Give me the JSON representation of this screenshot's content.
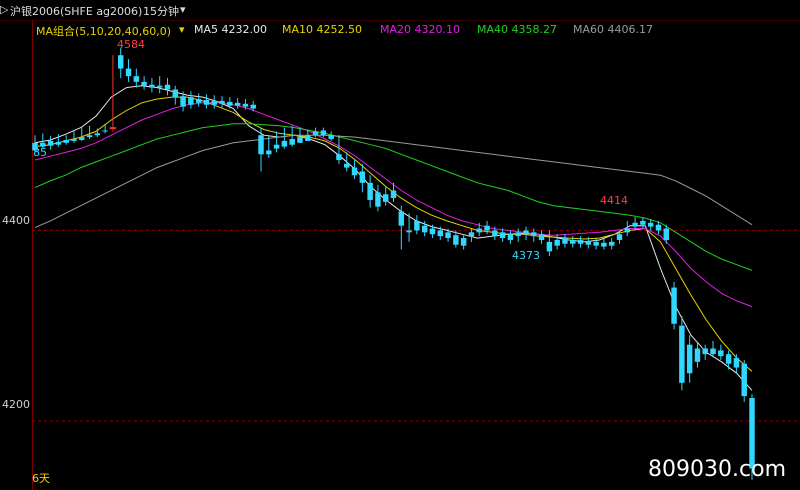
{
  "header": {
    "symbol": "沪银2006(SHFE ag2006)",
    "period": "15分钟",
    "period_caret": "▾",
    "left_caret": "▷"
  },
  "ma_group": {
    "label": "MA组合(5,10,20,40,60,0)",
    "dropdown": "▾",
    "items": [
      {
        "label": "MA5 4232.00",
        "color": "#e8e8e8"
      },
      {
        "label": "MA10 4252.50",
        "color": "#e6d400"
      },
      {
        "label": "MA20 4320.10",
        "color": "#e020e0"
      },
      {
        "label": "MA40 4358.27",
        "color": "#20d020"
      },
      {
        "label": "MA60 4406.17",
        "color": "#9a9a9a"
      }
    ]
  },
  "annotations": {
    "high1": "4584",
    "high2": "4414",
    "low1": "4373",
    "left_cut": "85"
  },
  "footer": {
    "days": "6天",
    "watermark": "809030.com"
  },
  "chart_data": {
    "type": "candlestick",
    "y_ticks": [
      4400,
      4200
    ],
    "ylim": [
      4140,
      4600
    ],
    "colors": {
      "up": "#ff3030",
      "down": "#30d8ff",
      "grid": "#8a0000"
    },
    "candles": [
      [
        4492,
        4500,
        4484,
        4482
      ],
      [
        4492,
        4502,
        4488,
        4486
      ],
      [
        4494,
        4499,
        4489,
        4485
      ],
      [
        4493,
        4501,
        4490,
        4488
      ],
      [
        4495,
        4500,
        4492,
        4490
      ],
      [
        4496,
        4505,
        4494,
        4492
      ],
      [
        4498,
        4508,
        4495,
        4494
      ],
      [
        4500,
        4510,
        4498,
        4496
      ],
      [
        4502,
        4507,
        4500,
        4498
      ],
      [
        4505,
        4512,
        4504,
        4502
      ],
      [
        4508,
        4584,
        4508,
        4504
      ],
      [
        4584,
        4592,
        4570,
        4560
      ],
      [
        4570,
        4580,
        4562,
        4556
      ],
      [
        4562,
        4570,
        4556,
        4550
      ],
      [
        4556,
        4562,
        4552,
        4548
      ],
      [
        4553,
        4560,
        4550,
        4545
      ],
      [
        4552,
        4562,
        4550,
        4544
      ],
      [
        4553,
        4560,
        4548,
        4542
      ],
      [
        4548,
        4552,
        4540,
        4532
      ],
      [
        4541,
        4546,
        4530,
        4525
      ],
      [
        4540,
        4546,
        4532,
        4528
      ],
      [
        4538,
        4544,
        4534,
        4530
      ],
      [
        4537,
        4543,
        4532,
        4528
      ],
      [
        4536,
        4542,
        4532,
        4528
      ],
      [
        4536,
        4541,
        4533,
        4529
      ],
      [
        4535,
        4540,
        4531,
        4528
      ],
      [
        4534,
        4539,
        4531,
        4528
      ],
      [
        4533,
        4538,
        4530,
        4527
      ],
      [
        4532,
        4536,
        4528,
        4525
      ],
      [
        4500,
        4508,
        4480,
        4462
      ],
      [
        4484,
        4500,
        4480,
        4476
      ],
      [
        4490,
        4504,
        4486,
        4482
      ],
      [
        4494,
        4508,
        4488,
        4486
      ],
      [
        4496,
        4510,
        4490,
        4488
      ],
      [
        4498,
        4508,
        4492,
        4492
      ],
      [
        4500,
        4506,
        4494,
        4494
      ],
      [
        4504,
        4508,
        4500,
        4498
      ],
      [
        4505,
        4508,
        4500,
        4498
      ],
      [
        4500,
        4504,
        4496,
        4494
      ],
      [
        4480,
        4500,
        4474,
        4470
      ],
      [
        4470,
        4482,
        4466,
        4462
      ],
      [
        4466,
        4474,
        4458,
        4454
      ],
      [
        4462,
        4470,
        4450,
        4440
      ],
      [
        4450,
        4458,
        4432,
        4424
      ],
      [
        4440,
        4448,
        4425,
        4420
      ],
      [
        4438,
        4446,
        4430,
        4426
      ],
      [
        4442,
        4450,
        4434,
        4430
      ],
      [
        4420,
        4426,
        4405,
        4380
      ],
      [
        4400,
        4418,
        4398,
        4388
      ],
      [
        4410,
        4416,
        4400,
        4396
      ],
      [
        4405,
        4410,
        4398,
        4394
      ],
      [
        4402,
        4406,
        4396,
        4392
      ],
      [
        4400,
        4404,
        4394,
        4390
      ],
      [
        4398,
        4402,
        4392,
        4388
      ],
      [
        4395,
        4400,
        4385,
        4382
      ],
      [
        4392,
        4396,
        4384,
        4380
      ],
      [
        4398,
        4402,
        4394,
        4388
      ],
      [
        4402,
        4408,
        4398,
        4394
      ],
      [
        4405,
        4410,
        4400,
        4396
      ],
      [
        4400,
        4404,
        4394,
        4390
      ],
      [
        4398,
        4402,
        4392,
        4388
      ],
      [
        4396,
        4400,
        4390,
        4386
      ],
      [
        4398,
        4402,
        4394,
        4388
      ],
      [
        4400,
        4404,
        4396,
        4390
      ],
      [
        4398,
        4402,
        4394,
        4388
      ],
      [
        4396,
        4400,
        4390,
        4386
      ],
      [
        4388,
        4400,
        4378,
        4373
      ],
      [
        4390,
        4396,
        4384,
        4380
      ],
      [
        4392,
        4396,
        4386,
        4382
      ],
      [
        4390,
        4394,
        4386,
        4382
      ],
      [
        4390,
        4394,
        4386,
        4382
      ],
      [
        4389,
        4393,
        4385,
        4381
      ],
      [
        4388,
        4392,
        4384,
        4380
      ],
      [
        4387,
        4391,
        4383,
        4380
      ],
      [
        4388,
        4392,
        4384,
        4380
      ],
      [
        4396,
        4400,
        4390,
        4386
      ],
      [
        4402,
        4410,
        4398,
        4394
      ],
      [
        4408,
        4414,
        4404,
        4400
      ],
      [
        4410,
        4414,
        4406,
        4402
      ],
      [
        4408,
        4412,
        4404,
        4400
      ],
      [
        4406,
        4410,
        4400,
        4396
      ],
      [
        4402,
        4406,
        4390,
        4386
      ],
      [
        4340,
        4346,
        4302,
        4296
      ],
      [
        4300,
        4310,
        4240,
        4232
      ],
      [
        4280,
        4290,
        4250,
        4240
      ],
      [
        4276,
        4282,
        4262,
        4256
      ],
      [
        4276,
        4280,
        4270,
        4264
      ],
      [
        4276,
        4284,
        4270,
        4268
      ],
      [
        4274,
        4280,
        4268,
        4264
      ],
      [
        4270,
        4274,
        4260,
        4254
      ],
      [
        4266,
        4270,
        4256,
        4250
      ],
      [
        4260,
        4264,
        4226,
        4220
      ],
      [
        4224,
        4228,
        4150,
        4138
      ]
    ],
    "ma_series": [
      {
        "name": "MA5",
        "color": "#e8e8e8",
        "values": [
          4492,
          4495,
          4501,
          4508,
          4520,
          4540,
          4550,
          4552,
          4550,
          4546,
          4542,
          4540,
          4535,
          4528,
          4510,
          4500,
          4498,
          4500,
          4496,
          4490,
          4478,
          4464,
          4446,
          4432,
          4420,
          4410,
          4404,
          4400,
          4396,
          4392,
          4394,
          4396,
          4397,
          4396,
          4393,
          4390,
          4388,
          4390,
          4396,
          4405,
          4405,
          4360,
          4320,
          4290,
          4272,
          4262,
          4250,
          4232
        ]
      },
      {
        "name": "MA10",
        "color": "#e6d400",
        "values": [
          4488,
          4490,
          4494,
          4498,
          4504,
          4516,
          4526,
          4534,
          4538,
          4540,
          4540,
          4536,
          4530,
          4524,
          4514,
          4506,
          4502,
          4500,
          4498,
          4494,
          4486,
          4474,
          4460,
          4446,
          4434,
          4424,
          4416,
          4410,
          4405,
          4400,
          4398,
          4396,
          4396,
          4394,
          4393,
          4392,
          4391,
          4392,
          4396,
          4400,
          4402,
          4388,
          4360,
          4332,
          4306,
          4284,
          4266,
          4252
        ]
      },
      {
        "name": "MA20",
        "color": "#e020e0",
        "values": [
          4474,
          4478,
          4482,
          4486,
          4492,
          4500,
          4508,
          4516,
          4522,
          4528,
          4532,
          4534,
          4534,
          4532,
          4528,
          4522,
          4516,
          4510,
          4504,
          4496,
          4488,
          4478,
          4466,
          4454,
          4442,
          4432,
          4424,
          4416,
          4410,
          4406,
          4402,
          4400,
          4398,
          4396,
          4395,
          4396,
          4397,
          4398,
          4400,
          4402,
          4402,
          4394,
          4378,
          4360,
          4346,
          4334,
          4326,
          4320
        ]
      },
      {
        "name": "MA40",
        "color": "#20d020",
        "values": [
          4445,
          4452,
          4458,
          4466,
          4472,
          4478,
          4484,
          4490,
          4496,
          4500,
          4504,
          4508,
          4510,
          4512,
          4512,
          4511,
          4510,
          4508,
          4505,
          4502,
          4498,
          4494,
          4490,
          4486,
          4480,
          4474,
          4468,
          4462,
          4456,
          4450,
          4446,
          4442,
          4436,
          4430,
          4426,
          4424,
          4422,
          4420,
          4418,
          4416,
          4413,
          4408,
          4398,
          4388,
          4378,
          4370,
          4364,
          4358
        ]
      },
      {
        "name": "MA60",
        "color": "#9a9a9a",
        "values": [
          4403,
          4410,
          4418,
          4426,
          4434,
          4442,
          4450,
          4458,
          4466,
          4472,
          4478,
          4484,
          4488,
          4492,
          4494,
          4496,
          4498,
          4500,
          4500,
          4500,
          4499,
          4498,
          4496,
          4494,
          4492,
          4490,
          4488,
          4486,
          4484,
          4482,
          4480,
          4478,
          4476,
          4474,
          4472,
          4470,
          4468,
          4466,
          4464,
          4462,
          4460,
          4458,
          4452,
          4444,
          4436,
          4426,
          4416,
          4406
        ]
      }
    ]
  }
}
